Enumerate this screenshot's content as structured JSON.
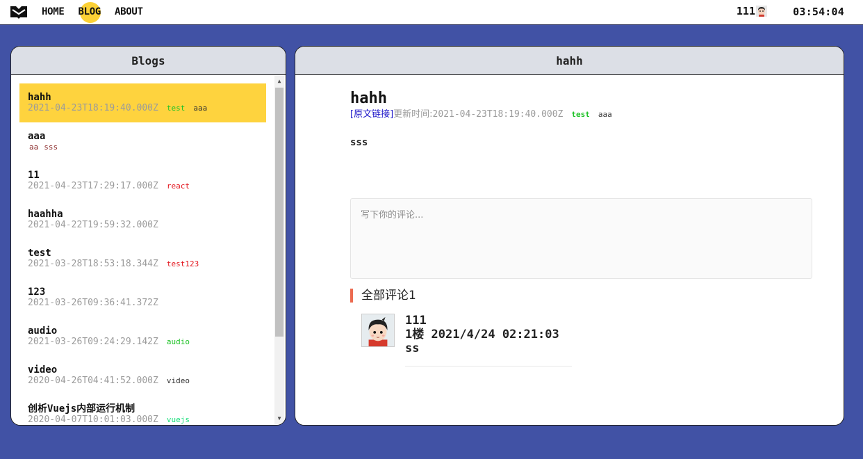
{
  "nav": {
    "links": [
      "HOME",
      "BLOG",
      "ABOUT"
    ],
    "active": "BLOG",
    "user": "111",
    "clock": "03:54:04"
  },
  "left_panel": {
    "title": "Blogs",
    "items": [
      {
        "title": "hahh",
        "date": "2021-04-23T18:19:40.000Z",
        "tags": [
          "test",
          "aaa"
        ],
        "selected": true
      },
      {
        "title": "aaa",
        "date": "",
        "tags": [
          "aa",
          "sss"
        ],
        "selected": false
      },
      {
        "title": "11",
        "date": "2021-04-23T17:29:17.000Z",
        "tags": [
          "react"
        ],
        "selected": false
      },
      {
        "title": "haahha",
        "date": "2021-04-22T19:59:32.000Z",
        "tags": [],
        "selected": false
      },
      {
        "title": "test",
        "date": "2021-03-28T18:53:18.344Z",
        "tags": [
          "test123"
        ],
        "selected": false
      },
      {
        "title": "123",
        "date": "2021-03-26T09:36:41.372Z",
        "tags": [],
        "selected": false
      },
      {
        "title": "audio",
        "date": "2021-03-26T09:24:29.142Z",
        "tags": [
          "audio"
        ],
        "selected": false
      },
      {
        "title": "video",
        "date": "2020-04-26T04:41:52.000Z",
        "tags": [
          "video"
        ],
        "selected": false
      },
      {
        "title": "创析Vuejs内部运行机制",
        "date": "2020-04-07T10:01:03.000Z",
        "tags": [
          "vuejs"
        ],
        "selected": false
      }
    ]
  },
  "right_panel": {
    "title": "hahh",
    "article": {
      "title": "hahh",
      "origin_link": "[原文链接]",
      "updated_label": "更新时间:",
      "updated": "2021-04-23T18:19:40.000Z",
      "tags": [
        "test",
        "aaa"
      ],
      "body": "sss"
    },
    "comment_placeholder": "写下你的评论...",
    "all_comments_label": "全部评论",
    "comment_count": "1",
    "comments": [
      {
        "user": "111",
        "floor": "1楼",
        "time": "2021/4/24 02:21:03",
        "text": "ss"
      }
    ]
  },
  "colors": {
    "background": "#4152a5",
    "selected": "#fed33e",
    "accent": "#ec6b50",
    "link": "#1e16c9"
  }
}
